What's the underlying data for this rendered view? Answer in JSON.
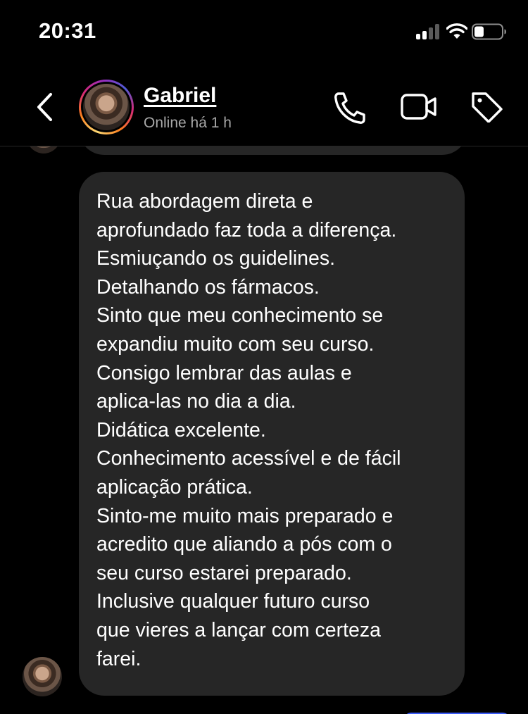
{
  "status_bar": {
    "time": "20:31",
    "signal_icon": "cellular-signal-icon",
    "wifi_icon": "wifi-icon",
    "battery_icon": "battery-icon",
    "battery_level": 0.35
  },
  "header": {
    "back_icon": "chevron-left-icon",
    "contact_name": "Gabriel",
    "contact_status": "Online há 1 h",
    "actions": [
      "phone-icon",
      "video-camera-icon",
      "tag-icon"
    ],
    "story_ring_colors": [
      "#feda75",
      "#fa7e1e",
      "#d62976",
      "#962fbf",
      "#4f5bd5"
    ]
  },
  "message": {
    "sender": "Gabriel",
    "bubble_color": "#262626",
    "lines": [
      "Rua abordagem direta e",
      "aprofundado faz toda a diferença.",
      "Esmiuçando os guidelines.",
      "Detalhando os fármacos.",
      "Sinto que meu conhecimento se",
      "expandiu muito com seu curso.",
      "Consigo lembrar das aulas e",
      "aplica-las no dia a dia.",
      "Didática excelente.",
      "Conhecimento acessível e de fácil",
      "aplicação prática.",
      "Sinto-me muito mais preparado e",
      "acredito que aliando a pós com o",
      "seu curso estarei preparado.",
      "Inclusive qualquer futuro curso",
      "que vieres a lançar com certeza",
      "farei."
    ]
  },
  "colors": {
    "background": "#000000",
    "secondary_text": "#a8a8a8",
    "outgoing_bubble": "#3b5bf6"
  }
}
